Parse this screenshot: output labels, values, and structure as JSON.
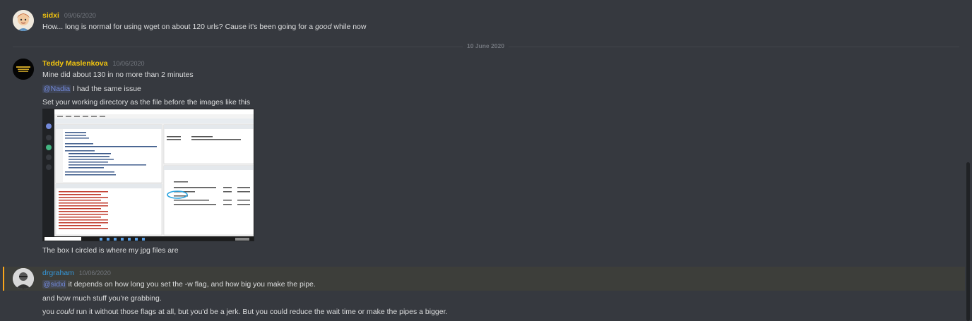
{
  "messages": [
    {
      "author": "sidxi",
      "author_color": "#f1c40f",
      "timestamp": "09/06/2020",
      "lines": [
        {
          "pre": "How... long is normal for using wget on about 120 urls? Cause it's been going for a ",
          "em": "good",
          "post": " while now"
        }
      ]
    },
    {
      "author": "Teddy Maslenkova",
      "author_color": "#f1c40f",
      "timestamp": "10/06/2020",
      "lines": [
        {
          "text": "Mine did about 130 in no more than 2 minutes"
        },
        {
          "mention": "@Nadia",
          "text": " I had the same issue"
        },
        {
          "text": "Set your working directory as the file before the images like this"
        },
        {
          "text": "The box I circled is where my jpg files are"
        }
      ]
    },
    {
      "author": "drgraham",
      "author_color": "#3498db",
      "timestamp": "10/06/2020",
      "lines": [
        {
          "mention": "@sidxi",
          "text": " it depends on how long you set the -w flag, and how big you make the pipe."
        },
        {
          "text": "and how much stuff you're grabbing."
        },
        {
          "pre": "you ",
          "em": "could",
          "post": " run it without those flags at all, but you'd be a jerk. But you could reduce the wait time or make the pipes a bigger."
        }
      ]
    }
  ],
  "divider": {
    "label": "10 June 2020"
  },
  "attachment": {
    "console_lines": [
      "image too small to fit",
      "Error in file(con, \"wb\")",
      "image too small to fit",
      "Error in file(con, \"wb\")",
      "image too small to fit",
      "image too small to fit"
    ],
    "taskbar_search": "Type here to search"
  }
}
